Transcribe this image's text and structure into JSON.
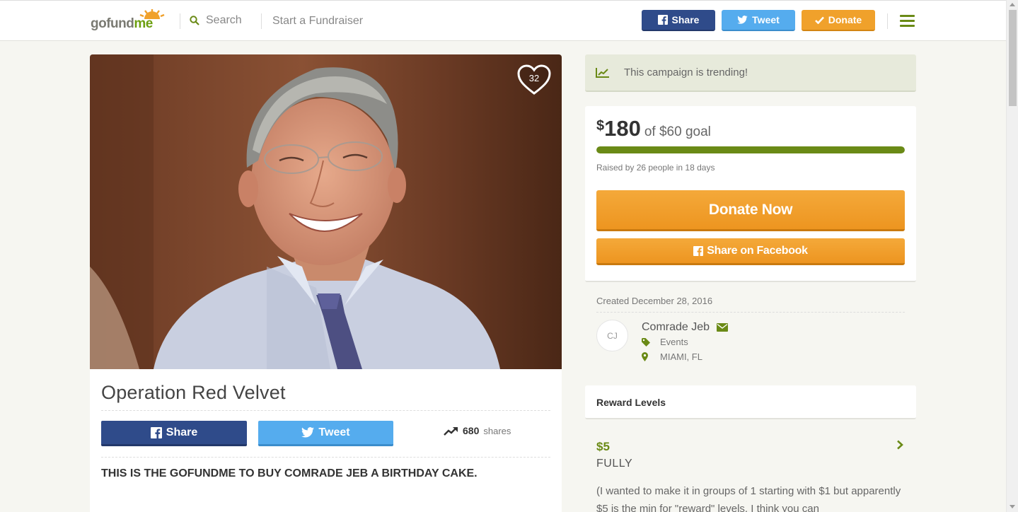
{
  "header": {
    "logo": {
      "prefix": "gofund",
      "suffix": "me"
    },
    "search_label": "Search",
    "start_label": "Start a Fundraiser",
    "share_label": "Share",
    "tweet_label": "Tweet",
    "donate_label": "Donate",
    "icons": {
      "search": "search-icon",
      "facebook": "facebook-icon",
      "twitter": "twitter-icon",
      "check": "check-icon",
      "menu": "hamburger-menu-icon"
    }
  },
  "campaign": {
    "title": "Operation Red Velvet",
    "heart_count": "32",
    "share_label": "Share",
    "tweet_label": "Tweet",
    "shares_count": "680",
    "shares_label": "shares",
    "description": "THIS IS THE GOFUNDME TO BUY COMRADE JEB A BIRTHDAY CAKE."
  },
  "sidebar": {
    "trending_text": "This campaign is trending!",
    "currency": "$",
    "raised": "180",
    "goal_text": "of $60 goal",
    "progress_fraction": 1.0,
    "raised_by": "Raised by 26 people in 18 days",
    "donate_now_label": "Donate Now",
    "share_facebook_label": "Share on Facebook",
    "created": "Created December 28, 2016",
    "organizer": {
      "initials": "CJ",
      "name": "Comrade Jeb",
      "category": "Events",
      "location": "MIAMI, FL"
    },
    "reward_levels_title": "Reward Levels",
    "reward": {
      "amount": "$5",
      "title": "FULLY",
      "description": "(I wanted to make it in groups of 1 starting with $1 but apparently $5 is the min for \"reward\" levels. I think you can"
    }
  },
  "colors": {
    "brand_green": "#6a8a16",
    "facebook_blue": "#2f4b8a",
    "twitter_blue": "#55acee",
    "donate_orange": "#f0a12b"
  }
}
